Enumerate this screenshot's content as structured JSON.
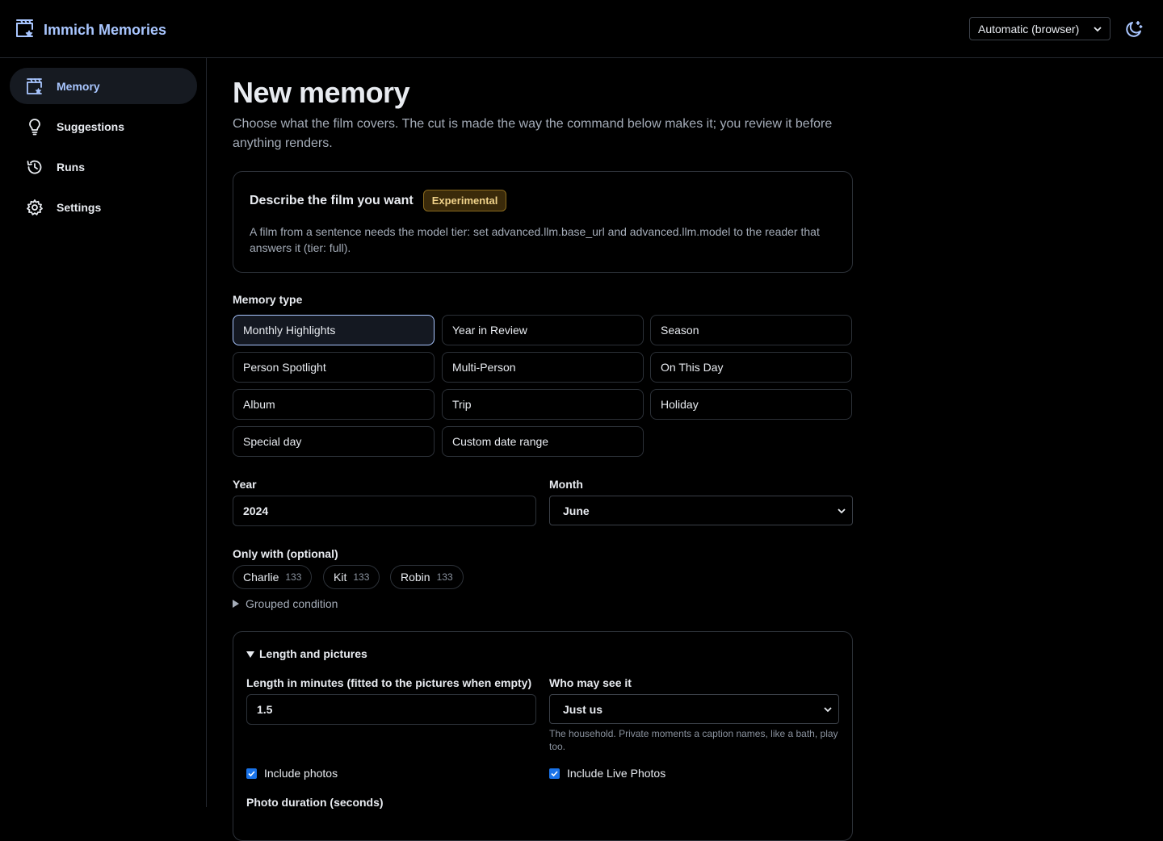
{
  "app": {
    "title": "Immich Memories",
    "theme_select": "Automatic (browser)",
    "icons": {
      "logo": "clapperboard-star-icon",
      "theme": "moon-icon"
    }
  },
  "sidebar": {
    "items": [
      {
        "label": "Memory",
        "icon": "clapperboard-icon",
        "active": true
      },
      {
        "label": "Suggestions",
        "icon": "lightbulb-icon",
        "active": false
      },
      {
        "label": "Runs",
        "icon": "history-icon",
        "active": false
      },
      {
        "label": "Settings",
        "icon": "gear-icon",
        "active": false
      }
    ]
  },
  "page": {
    "title": "New memory",
    "subtitle": "Choose what the film covers. The cut is made the way the command below makes it; you review it before anything renders."
  },
  "describe_card": {
    "title": "Describe the film you want",
    "badge": "Experimental",
    "text": "A film from a sentence needs the model tier: set advanced.llm.base_url and advanced.llm.model to the reader that answers it (tier: full)."
  },
  "memory_type": {
    "label": "Memory type",
    "selected": "Monthly Highlights",
    "options": [
      "Monthly Highlights",
      "Year in Review",
      "Season",
      "Person Spotlight",
      "Multi-Person",
      "On This Day",
      "Album",
      "Trip",
      "Holiday",
      "Special day",
      "Custom date range"
    ]
  },
  "year": {
    "label": "Year",
    "value": "2024"
  },
  "month": {
    "label": "Month",
    "value": "June"
  },
  "only_with": {
    "label": "Only with (optional)",
    "people": [
      {
        "name": "Charlie",
        "count": "133"
      },
      {
        "name": "Kit",
        "count": "133"
      },
      {
        "name": "Robin",
        "count": "133"
      }
    ],
    "grouped": "Grouped condition"
  },
  "length_section": {
    "title": "Length and pictures",
    "length_label": "Length in minutes (fitted to the pictures when empty)",
    "length_value": "1.5",
    "who_label": "Who may see it",
    "who_value": "Just us",
    "who_hint": "The household. Private moments a caption names, like a bath, play too.",
    "include_photos": "Include photos",
    "include_live": "Include Live Photos",
    "photo_duration_label": "Photo duration (seconds)"
  },
  "colors": {
    "accent": "#a9c6ff",
    "checkbox": "#1a73e8",
    "badge_bg": "#3a2a0a",
    "badge_text": "#f0d28a"
  }
}
